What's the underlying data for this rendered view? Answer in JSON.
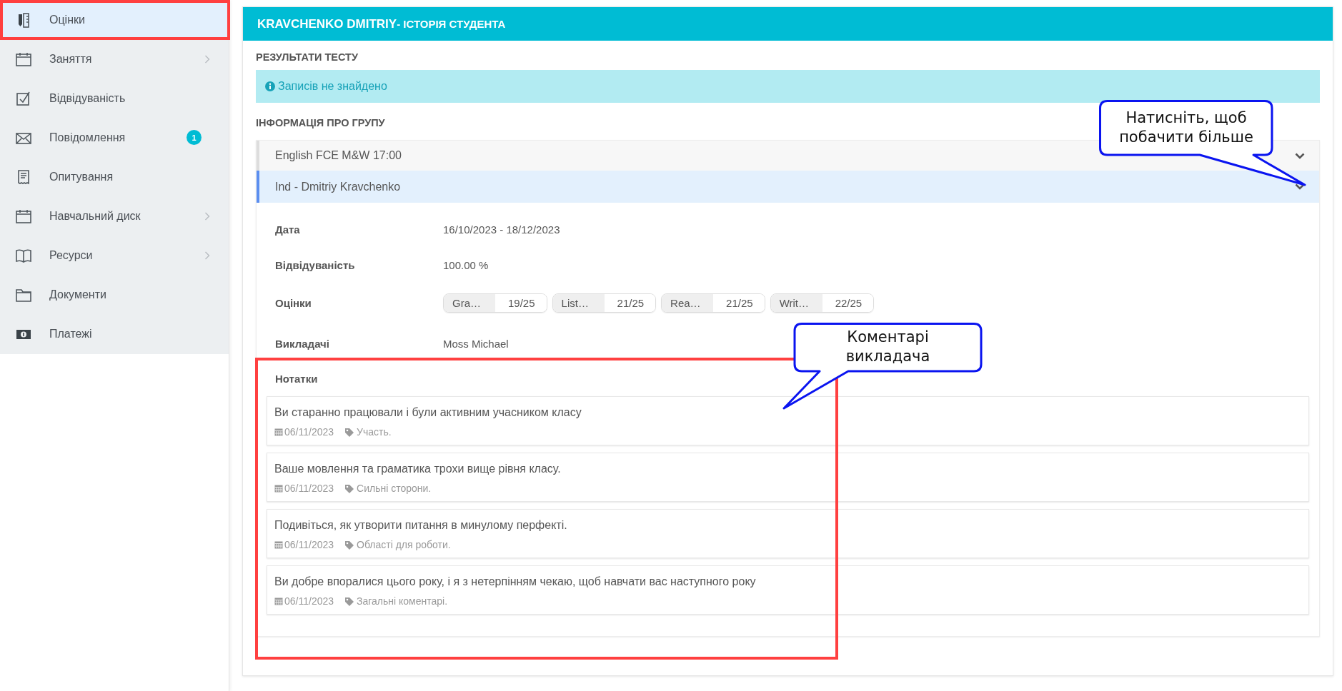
{
  "sidebar": {
    "items": [
      {
        "kind": "grades",
        "label": "Оцінки",
        "selected": true,
        "has_submenu": false
      },
      {
        "kind": "calendar",
        "label": "Заняття",
        "selected": false,
        "has_submenu": true
      },
      {
        "kind": "check",
        "label": "Відвідуваність",
        "selected": false,
        "has_submenu": false
      },
      {
        "kind": "mail",
        "label": "Повідомлення",
        "selected": false,
        "has_submenu": false,
        "badge": "1"
      },
      {
        "kind": "survey",
        "label": "Опитування",
        "selected": false,
        "has_submenu": false
      },
      {
        "kind": "calendar",
        "label": "Навчальний диск",
        "selected": false,
        "has_submenu": true
      },
      {
        "kind": "book",
        "label": "Ресурси",
        "selected": false,
        "has_submenu": true
      },
      {
        "kind": "folder",
        "label": "Документи",
        "selected": false,
        "has_submenu": false
      },
      {
        "kind": "money",
        "label": "Платежі",
        "selected": false,
        "has_submenu": false
      }
    ]
  },
  "panel": {
    "title_name": "KRAVCHENKO DMITRIY",
    "title_rest": " - ІСТОРІЯ СТУДЕНТА",
    "test_results": {
      "heading": "РЕЗУЛЬТАТИ ТЕСТУ",
      "message": "Записів не знайдено"
    },
    "group_info": {
      "heading": "ІНФОРМАЦІЯ ПРО ГРУПУ",
      "groups": [
        {
          "name": "English FCE M&W 17:00",
          "selected": false
        },
        {
          "name": "Ind - Dmitriy Kravchenko",
          "selected": true
        }
      ],
      "details": [
        {
          "kind": "text",
          "label": "Дата",
          "value": "16/10/2023 - 18/12/2023"
        },
        {
          "kind": "text",
          "label": "Відвідуваність",
          "value": "100.00 %"
        },
        {
          "kind": "scores",
          "label": "Оцінки",
          "scores": [
            {
              "name": "Gra…",
              "value": "19/25"
            },
            {
              "name": "List…",
              "value": "21/25"
            },
            {
              "name": "Rea…",
              "value": "21/25"
            },
            {
              "name": "Writ…",
              "value": "22/25"
            }
          ]
        },
        {
          "kind": "text",
          "label": "Викладачі",
          "value": "Moss Michael"
        }
      ],
      "notes_heading": "Нотатки",
      "notes": [
        {
          "text": "Ви старанно працювали і були активним учасником класу",
          "date": "06/11/2023",
          "tag": "Участь."
        },
        {
          "text": "Ваше мовлення та граматика трохи вище рівня класу.",
          "date": "06/11/2023",
          "tag": "Сильні сторони."
        },
        {
          "text": "Подивіться, як утворити питання в минулому перфекті.",
          "date": "06/11/2023",
          "tag": "Області для роботи."
        },
        {
          "text": "Ви добре впоралися цього року, і я з нетерпінням чекаю, щоб навчати вас наступного року",
          "date": "06/11/2023",
          "tag": "Загальні коментарі."
        }
      ]
    }
  },
  "callouts": [
    {
      "text": "Натисніть, щоб побачити більше"
    },
    {
      "text": "Коментарі викладача"
    }
  ]
}
